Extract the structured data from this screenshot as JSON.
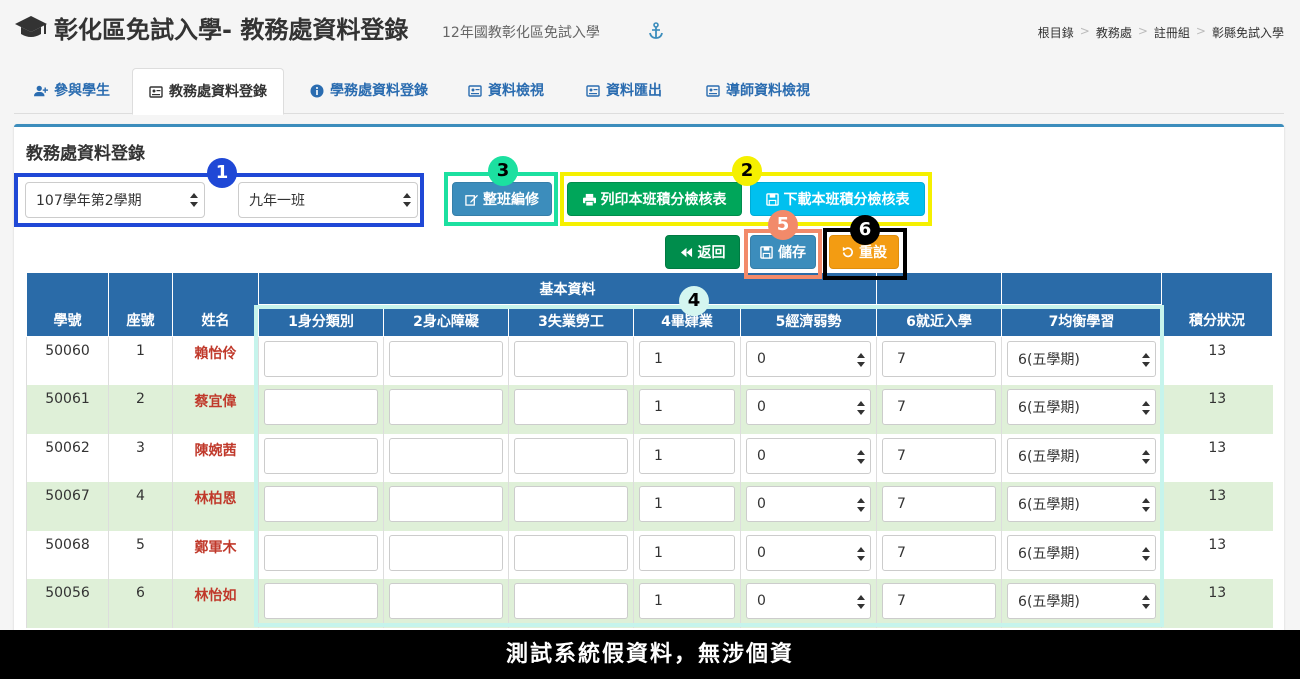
{
  "header": {
    "title": "彰化區免試入學- 教務處資料登錄",
    "subtitle": "12年國教彰化區免試入學",
    "breadcrumb": [
      "根目錄",
      "教務處",
      "註冊組",
      "彰縣免試入學"
    ]
  },
  "tabs": [
    {
      "label": "參與學生",
      "icon": "user-plus-icon"
    },
    {
      "label": "教務處資料登錄",
      "icon": "id-card-icon",
      "active": true
    },
    {
      "label": "學務處資料登錄",
      "icon": "info-circle-icon"
    },
    {
      "label": "資料檢視",
      "icon": "id-card-icon"
    },
    {
      "label": "資料匯出",
      "icon": "id-card-icon"
    },
    {
      "label": "導師資料檢視",
      "icon": "id-card-icon"
    }
  ],
  "panel": {
    "title": "教務處資料登錄",
    "semester_select": "107學年第2學期",
    "class_select": "九年一班"
  },
  "buttons": {
    "edit_class": "整班編修",
    "print": "列印本班積分檢核表",
    "download": "下載本班積分檢核表",
    "back": "返回",
    "save": "儲存",
    "reset": "重設"
  },
  "badges": [
    "1",
    "2",
    "3",
    "4",
    "5",
    "6"
  ],
  "table": {
    "headers": {
      "id": "學號",
      "seat": "座號",
      "name": "姓名",
      "basic": "基本資料",
      "c1": "1身分類別",
      "c2": "2身心障礙",
      "c3": "3失業勞工",
      "c4": "4畢肄業",
      "c5": "5經濟弱勢",
      "c6": "6就近入學",
      "c7": "7均衡學習",
      "score": "積分狀況"
    },
    "rows": [
      {
        "id": "50060",
        "seat": "1",
        "name": "賴怡伶",
        "c4": "1",
        "c5": "0",
        "c6": "7",
        "c7": "6(五學期)",
        "score": "13"
      },
      {
        "id": "50061",
        "seat": "2",
        "name": "蔡宜偉",
        "c4": "1",
        "c5": "0",
        "c6": "7",
        "c7": "6(五學期)",
        "score": "13"
      },
      {
        "id": "50062",
        "seat": "3",
        "name": "陳婉茜",
        "c4": "1",
        "c5": "0",
        "c6": "7",
        "c7": "6(五學期)",
        "score": "13"
      },
      {
        "id": "50067",
        "seat": "4",
        "name": "林柏恩",
        "c4": "1",
        "c5": "0",
        "c6": "7",
        "c7": "6(五學期)",
        "score": "13"
      },
      {
        "id": "50068",
        "seat": "5",
        "name": "鄭軍木",
        "c4": "1",
        "c5": "0",
        "c6": "7",
        "c7": "6(五學期)",
        "score": "13"
      },
      {
        "id": "50056",
        "seat": "6",
        "name": "林怡如",
        "c4": "1",
        "c5": "0",
        "c6": "7",
        "c7": "6(五學期)",
        "score": "13"
      }
    ]
  },
  "footer": "測試系統假資料，無涉個資",
  "colors": {
    "primary": "#3c8dbc",
    "success": "#00a65a",
    "info": "#00c0ef",
    "warning": "#f39c12",
    "header_blue": "#2a6ba8",
    "row_green": "#dff0d8"
  }
}
